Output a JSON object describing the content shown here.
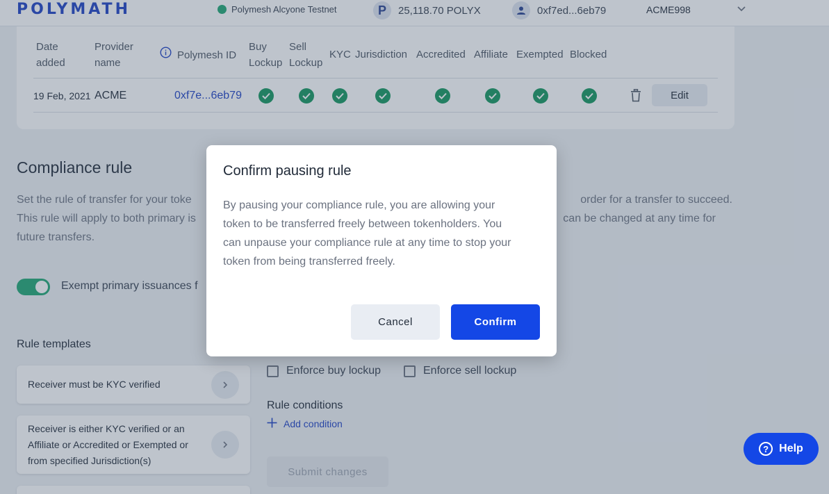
{
  "header": {
    "logo": "POLYMATH",
    "network": "Polymesh Alcyone Testnet",
    "balance_icon": "P",
    "balance": "25,118.70 POLYX",
    "account": "0xf7ed...6eb79",
    "ticker": "ACME998"
  },
  "providers_table": {
    "columns": [
      "Date added",
      "Provider name",
      "Polymesh ID",
      "Buy Lockup",
      "Sell Lockup",
      "KYC",
      "Jurisdiction",
      "Accredited",
      "Affiliate",
      "Exempted",
      "Blocked"
    ],
    "rows": [
      {
        "date": "19 Feb, 2021",
        "provider": "ACME",
        "polymesh_id": "0xf7e...6eb79",
        "edit_label": "Edit"
      }
    ]
  },
  "compliance": {
    "title": "Compliance rule",
    "description_left": "Set the rule of transfer for your toke",
    "description_right": "order for a transfer to succeed.",
    "description_line2_left": "This rule will apply to both primary is",
    "description_line2_right": "can be changed at any time for",
    "description_line3": "future transfers.",
    "exempt_label": "Exempt primary issuances f",
    "exempt_on": true
  },
  "rule_templates": {
    "title": "Rule templates",
    "items": [
      {
        "label": "Receiver must be KYC verified"
      },
      {
        "line1": "Receiver is either KYC verified or an",
        "line2": "Affiliate or Accredited or Exempted or",
        "line3": "from specified Jurisdiction(s)"
      }
    ]
  },
  "rule_editor": {
    "buy_lockup": "Enforce buy lockup",
    "sell_lockup": "Enforce sell lockup",
    "conditions_title": "Rule conditions",
    "add_condition": "Add condition",
    "submit": "Submit changes"
  },
  "modal": {
    "title": "Confirm pausing rule",
    "line1": "By pausing your compliance rule, you are allowing your",
    "line2": "token to be transferred freely between tokenholders. You",
    "line3": "can unpause your compliance rule at any time to stop your",
    "line4": "token from being transferred freely.",
    "cancel": "Cancel",
    "confirm": "Confirm"
  },
  "help": {
    "label": "Help"
  },
  "colors": {
    "accent": "#1447e6",
    "success": "#12965c",
    "brand": "#1c3fc4"
  }
}
